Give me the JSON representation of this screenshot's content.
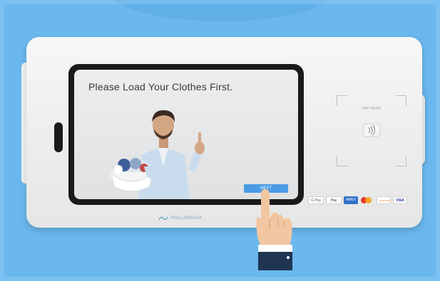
{
  "screen": {
    "title": "Please Load Your Clothes First.",
    "button_label": "NEXT"
  },
  "brand": {
    "name": "ROLLARGAPA"
  },
  "reader": {
    "label": "TAP HERE"
  },
  "payments": {
    "gpay": "G Pay",
    "apay": "Pay",
    "amex": "AMEX",
    "discover": "DISCOVER",
    "visa": "VISA"
  },
  "colors": {
    "background": "#6bb8ee",
    "button": "#4a9be6",
    "kiosk": "#f0f0f0",
    "bezel": "#1a1a1a"
  }
}
